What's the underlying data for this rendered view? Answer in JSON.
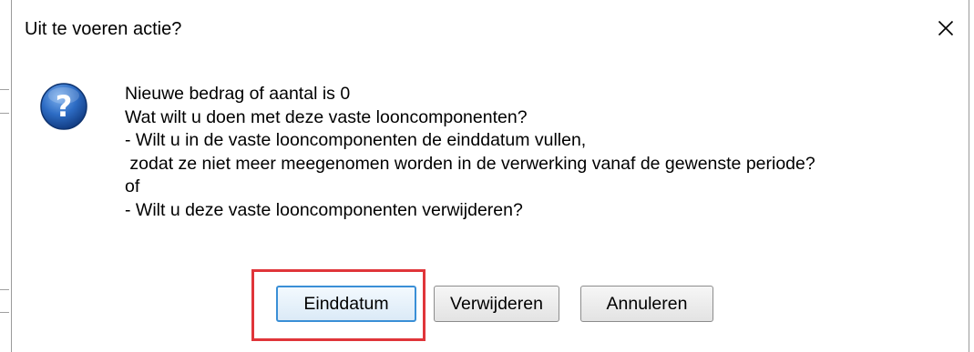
{
  "dialog": {
    "title": "Uit te voeren actie?",
    "close_icon": "close-icon",
    "message_icon": "question-icon",
    "message_lines": [
      "Nieuwe bedrag of aantal is 0",
      "Wat wilt u doen met deze vaste looncomponenten?",
      "- Wilt u in de vaste looncomponenten de einddatum vullen,",
      " zodat ze niet meer meegenomen worden in de verwerking vanaf de gewenste periode?",
      "of",
      "- Wilt u deze vaste looncomponenten verwijderen?"
    ],
    "buttons": {
      "einddatum": "Einddatum",
      "verwijderen": "Verwijderen",
      "annuleren": "Annuleren"
    },
    "highlight_color": "#e0353a",
    "icon_color": "#1f5fae"
  }
}
